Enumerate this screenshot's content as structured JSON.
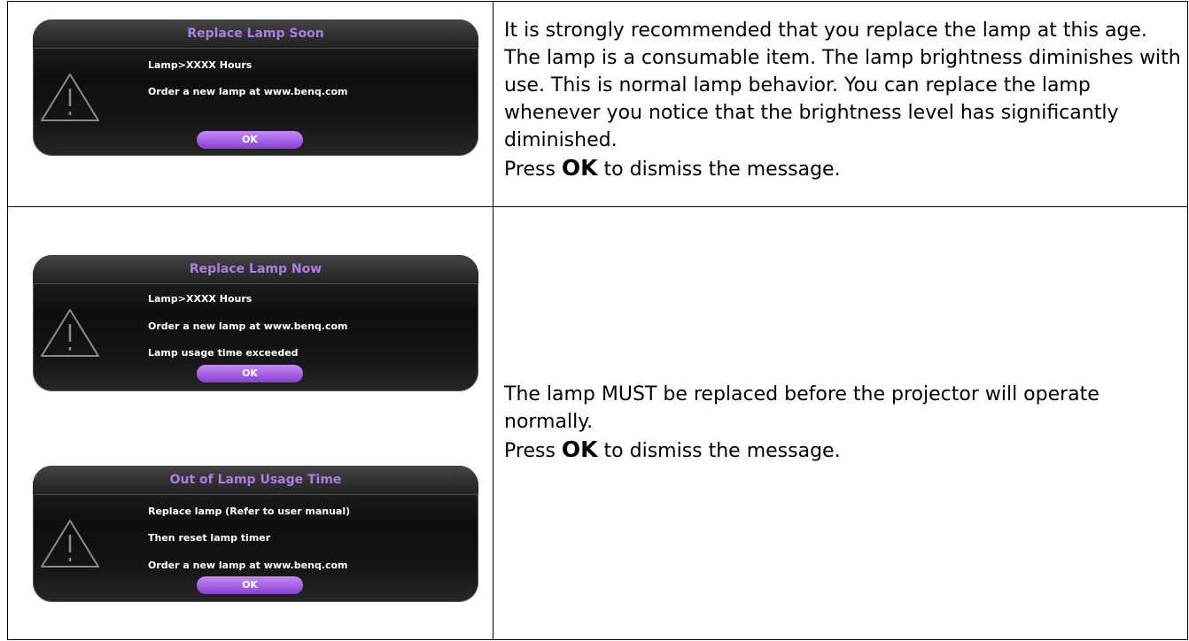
{
  "rows": [
    {
      "dialogs": [
        {
          "title": "Replace Lamp Soon",
          "lines": [
            "Lamp>XXXX Hours",
            "Order a new lamp at www.benq.com"
          ],
          "button": "OK"
        }
      ],
      "description": "It is strongly recommended that you replace the lamp at this age. The lamp is a consumable item. The lamp brightness diminishes with use. This is normal lamp behavior. You can replace the lamp whenever you notice that the brightness level has significantly diminished.",
      "press_prefix": "Press",
      "press_key": "OK",
      "press_suffix": "to dismiss the message."
    },
    {
      "dialogs": [
        {
          "title": "Replace Lamp Now",
          "lines": [
            "Lamp>XXXX Hours",
            "Order a new lamp at www.benq.com",
            "Lamp usage time exceeded"
          ],
          "button": "OK"
        },
        {
          "title": "Out of Lamp Usage Time",
          "lines": [
            "Replace lamp (Refer to user manual)",
            "Then reset lamp timer",
            "Order a new lamp at www.benq.com"
          ],
          "button": "OK"
        }
      ],
      "description": "The lamp MUST be replaced before the projector will operate normally.",
      "press_prefix": "Press",
      "press_key": "OK",
      "press_suffix": "to dismiss the message."
    }
  ],
  "icons": {
    "warning": "warning-triangle-icon"
  },
  "colors": {
    "title_purple": "#b07be8",
    "button_purple": "#9b50e0"
  }
}
